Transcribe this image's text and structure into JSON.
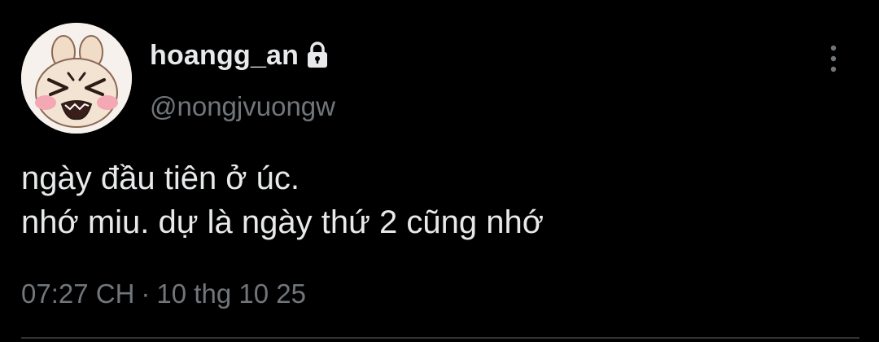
{
  "author": {
    "display_name": "hoangg_an",
    "handle": "@nongjvuongw",
    "protected_icon": "lock-icon",
    "avatar": "cartoon-face-avatar"
  },
  "tweet": {
    "lines": [
      "ngày đầu tiên ở úc.",
      "nhớ miu. dự là ngày thứ 2 cũng nhớ"
    ],
    "time": "07:27 CH",
    "separator": "·",
    "date": "10 thg 10 25"
  },
  "actions": {
    "more_icon": "more-vertical-icon"
  },
  "colors": {
    "background": "#000000",
    "primary_text": "#e7e9ea",
    "secondary_text": "#71767b"
  }
}
